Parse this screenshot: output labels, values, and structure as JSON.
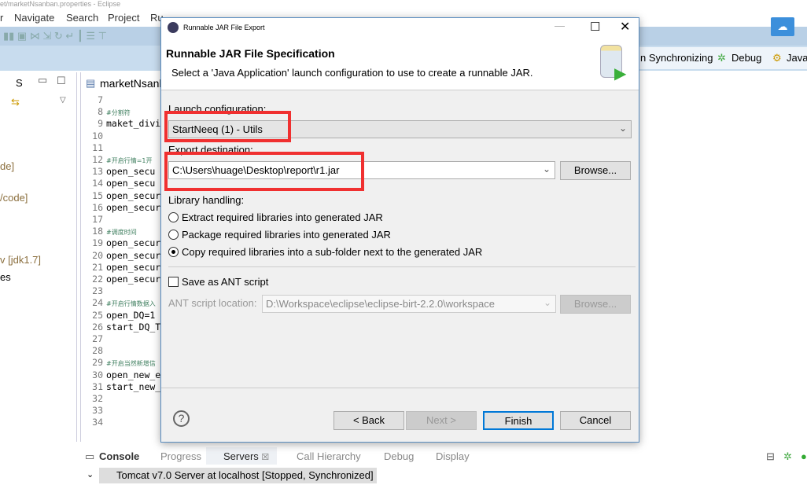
{
  "window": {
    "title": "et/marketNsanban.properties - Eclipse"
  },
  "menu": [
    "r",
    "Navigate",
    "Search",
    "Project",
    "Ru"
  ],
  "perspectives": [
    "n Synchronizing",
    "Debug",
    "Java"
  ],
  "left_pane": {
    "tab": "S",
    "items": [
      "de]",
      "/code]",
      "v [jdk1.7]",
      "es"
    ]
  },
  "editor": {
    "tab": "marketNsanb",
    "lines": [
      {
        "n": "7",
        "t": ""
      },
      {
        "n": "8",
        "t": "#分割符",
        "c": true
      },
      {
        "n": "9",
        "t": "maket_divi"
      },
      {
        "n": "10",
        "t": ""
      },
      {
        "n": "11",
        "t": ""
      },
      {
        "n": "12",
        "t": "#开启行情=1开",
        "c": true
      },
      {
        "n": "13",
        "t": "open_secu"
      },
      {
        "n": "14",
        "t": "open_secu"
      },
      {
        "n": "15",
        "t": "open_secur"
      },
      {
        "n": "16",
        "t": "open_secur"
      },
      {
        "n": "17",
        "t": ""
      },
      {
        "n": "18",
        "t": "#调度时间",
        "c": true
      },
      {
        "n": "19",
        "t": "open_secur"
      },
      {
        "n": "20",
        "t": "open_secur"
      },
      {
        "n": "21",
        "t": "open_secur"
      },
      {
        "n": "22",
        "t": "open_secur"
      },
      {
        "n": "23",
        "t": ""
      },
      {
        "n": "24",
        "t": "#开启行情数据入",
        "c": true
      },
      {
        "n": "25",
        "t": "open_DQ=1"
      },
      {
        "n": "26",
        "t": "start_DQ_T"
      },
      {
        "n": "27",
        "t": ""
      },
      {
        "n": "28",
        "t": ""
      },
      {
        "n": "29",
        "t": "#开启当然新增信",
        "c": true
      },
      {
        "n": "30",
        "t": "open_new_e"
      },
      {
        "n": "31",
        "t": "start_new_"
      },
      {
        "n": "32",
        "t": ""
      },
      {
        "n": "33",
        "t": ""
      },
      {
        "n": "34",
        "t": ""
      }
    ]
  },
  "bottom": {
    "tabs": [
      "Console",
      "Progress",
      "Servers",
      "Call Hierarchy",
      "Debug",
      "Display"
    ],
    "active": "Servers",
    "server": "Tomcat v7.0 Server at localhost  [Stopped, Synchronized]"
  },
  "dialog": {
    "title": "Runnable JAR File Export",
    "heading": "Runnable JAR File Specification",
    "description": "Select a 'Java Application' launch configuration to use to create a runnable JAR.",
    "launch_label": "Launch configuration:",
    "launch_value": "StartNeeq (1) - Utils",
    "export_label": "Export destination:",
    "export_value": "C:\\Users\\huage\\Desktop\\report\\r1.jar",
    "browse": "Browse...",
    "library_label": "Library handling:",
    "library_options": [
      "Extract required libraries into generated JAR",
      "Package required libraries into generated JAR",
      "Copy required libraries into a sub-folder next to the generated JAR"
    ],
    "library_selected": 2,
    "save_ant": "Save as ANT script",
    "save_ant_checked": false,
    "ant_label": "ANT script location:",
    "ant_value": "D:\\Workspace\\eclipse\\eclipse-birt-2.2.0\\workspace",
    "ant_browse": "Browse...",
    "buttons": {
      "back": "< Back",
      "next": "Next >",
      "finish": "Finish",
      "cancel": "Cancel"
    }
  },
  "colors": {
    "highlight": "#f03030",
    "accent": "#0078d7"
  }
}
